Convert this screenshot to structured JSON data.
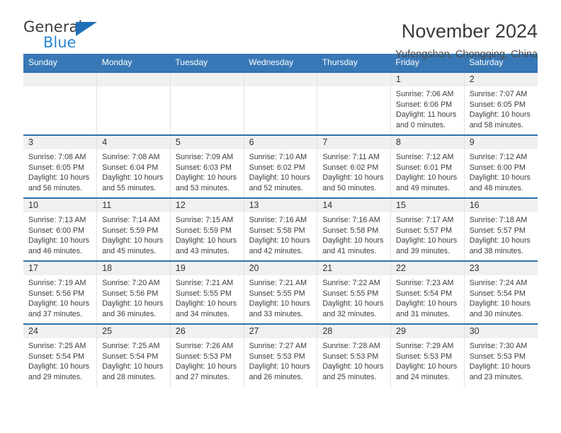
{
  "brand": {
    "name_part1": "General",
    "name_part2": "Blue",
    "accent_color": "#2a86d0",
    "triangle_color": "#1f6fb8"
  },
  "header": {
    "title": "November 2024",
    "subtitle": "Yufengshan, Chongqing, China",
    "header_bg_color": "#3878b6",
    "row_border_color": "#2f6fae"
  },
  "weekdays": [
    "Sunday",
    "Monday",
    "Tuesday",
    "Wednesday",
    "Thursday",
    "Friday",
    "Saturday"
  ],
  "weeks": [
    [
      {
        "day": "",
        "sunrise": "",
        "sunset": "",
        "daylight1": "",
        "daylight2": ""
      },
      {
        "day": "",
        "sunrise": "",
        "sunset": "",
        "daylight1": "",
        "daylight2": ""
      },
      {
        "day": "",
        "sunrise": "",
        "sunset": "",
        "daylight1": "",
        "daylight2": ""
      },
      {
        "day": "",
        "sunrise": "",
        "sunset": "",
        "daylight1": "",
        "daylight2": ""
      },
      {
        "day": "",
        "sunrise": "",
        "sunset": "",
        "daylight1": "",
        "daylight2": ""
      },
      {
        "day": "1",
        "sunrise": "Sunrise: 7:06 AM",
        "sunset": "Sunset: 6:06 PM",
        "daylight1": "Daylight: 11 hours",
        "daylight2": "and 0 minutes."
      },
      {
        "day": "2",
        "sunrise": "Sunrise: 7:07 AM",
        "sunset": "Sunset: 6:05 PM",
        "daylight1": "Daylight: 10 hours",
        "daylight2": "and 58 minutes."
      }
    ],
    [
      {
        "day": "3",
        "sunrise": "Sunrise: 7:08 AM",
        "sunset": "Sunset: 6:05 PM",
        "daylight1": "Daylight: 10 hours",
        "daylight2": "and 56 minutes."
      },
      {
        "day": "4",
        "sunrise": "Sunrise: 7:08 AM",
        "sunset": "Sunset: 6:04 PM",
        "daylight1": "Daylight: 10 hours",
        "daylight2": "and 55 minutes."
      },
      {
        "day": "5",
        "sunrise": "Sunrise: 7:09 AM",
        "sunset": "Sunset: 6:03 PM",
        "daylight1": "Daylight: 10 hours",
        "daylight2": "and 53 minutes."
      },
      {
        "day": "6",
        "sunrise": "Sunrise: 7:10 AM",
        "sunset": "Sunset: 6:02 PM",
        "daylight1": "Daylight: 10 hours",
        "daylight2": "and 52 minutes."
      },
      {
        "day": "7",
        "sunrise": "Sunrise: 7:11 AM",
        "sunset": "Sunset: 6:02 PM",
        "daylight1": "Daylight: 10 hours",
        "daylight2": "and 50 minutes."
      },
      {
        "day": "8",
        "sunrise": "Sunrise: 7:12 AM",
        "sunset": "Sunset: 6:01 PM",
        "daylight1": "Daylight: 10 hours",
        "daylight2": "and 49 minutes."
      },
      {
        "day": "9",
        "sunrise": "Sunrise: 7:12 AM",
        "sunset": "Sunset: 6:00 PM",
        "daylight1": "Daylight: 10 hours",
        "daylight2": "and 48 minutes."
      }
    ],
    [
      {
        "day": "10",
        "sunrise": "Sunrise: 7:13 AM",
        "sunset": "Sunset: 6:00 PM",
        "daylight1": "Daylight: 10 hours",
        "daylight2": "and 46 minutes."
      },
      {
        "day": "11",
        "sunrise": "Sunrise: 7:14 AM",
        "sunset": "Sunset: 5:59 PM",
        "daylight1": "Daylight: 10 hours",
        "daylight2": "and 45 minutes."
      },
      {
        "day": "12",
        "sunrise": "Sunrise: 7:15 AM",
        "sunset": "Sunset: 5:59 PM",
        "daylight1": "Daylight: 10 hours",
        "daylight2": "and 43 minutes."
      },
      {
        "day": "13",
        "sunrise": "Sunrise: 7:16 AM",
        "sunset": "Sunset: 5:58 PM",
        "daylight1": "Daylight: 10 hours",
        "daylight2": "and 42 minutes."
      },
      {
        "day": "14",
        "sunrise": "Sunrise: 7:16 AM",
        "sunset": "Sunset: 5:58 PM",
        "daylight1": "Daylight: 10 hours",
        "daylight2": "and 41 minutes."
      },
      {
        "day": "15",
        "sunrise": "Sunrise: 7:17 AM",
        "sunset": "Sunset: 5:57 PM",
        "daylight1": "Daylight: 10 hours",
        "daylight2": "and 39 minutes."
      },
      {
        "day": "16",
        "sunrise": "Sunrise: 7:18 AM",
        "sunset": "Sunset: 5:57 PM",
        "daylight1": "Daylight: 10 hours",
        "daylight2": "and 38 minutes."
      }
    ],
    [
      {
        "day": "17",
        "sunrise": "Sunrise: 7:19 AM",
        "sunset": "Sunset: 5:56 PM",
        "daylight1": "Daylight: 10 hours",
        "daylight2": "and 37 minutes."
      },
      {
        "day": "18",
        "sunrise": "Sunrise: 7:20 AM",
        "sunset": "Sunset: 5:56 PM",
        "daylight1": "Daylight: 10 hours",
        "daylight2": "and 36 minutes."
      },
      {
        "day": "19",
        "sunrise": "Sunrise: 7:21 AM",
        "sunset": "Sunset: 5:55 PM",
        "daylight1": "Daylight: 10 hours",
        "daylight2": "and 34 minutes."
      },
      {
        "day": "20",
        "sunrise": "Sunrise: 7:21 AM",
        "sunset": "Sunset: 5:55 PM",
        "daylight1": "Daylight: 10 hours",
        "daylight2": "and 33 minutes."
      },
      {
        "day": "21",
        "sunrise": "Sunrise: 7:22 AM",
        "sunset": "Sunset: 5:55 PM",
        "daylight1": "Daylight: 10 hours",
        "daylight2": "and 32 minutes."
      },
      {
        "day": "22",
        "sunrise": "Sunrise: 7:23 AM",
        "sunset": "Sunset: 5:54 PM",
        "daylight1": "Daylight: 10 hours",
        "daylight2": "and 31 minutes."
      },
      {
        "day": "23",
        "sunrise": "Sunrise: 7:24 AM",
        "sunset": "Sunset: 5:54 PM",
        "daylight1": "Daylight: 10 hours",
        "daylight2": "and 30 minutes."
      }
    ],
    [
      {
        "day": "24",
        "sunrise": "Sunrise: 7:25 AM",
        "sunset": "Sunset: 5:54 PM",
        "daylight1": "Daylight: 10 hours",
        "daylight2": "and 29 minutes."
      },
      {
        "day": "25",
        "sunrise": "Sunrise: 7:25 AM",
        "sunset": "Sunset: 5:54 PM",
        "daylight1": "Daylight: 10 hours",
        "daylight2": "and 28 minutes."
      },
      {
        "day": "26",
        "sunrise": "Sunrise: 7:26 AM",
        "sunset": "Sunset: 5:53 PM",
        "daylight1": "Daylight: 10 hours",
        "daylight2": "and 27 minutes."
      },
      {
        "day": "27",
        "sunrise": "Sunrise: 7:27 AM",
        "sunset": "Sunset: 5:53 PM",
        "daylight1": "Daylight: 10 hours",
        "daylight2": "and 26 minutes."
      },
      {
        "day": "28",
        "sunrise": "Sunrise: 7:28 AM",
        "sunset": "Sunset: 5:53 PM",
        "daylight1": "Daylight: 10 hours",
        "daylight2": "and 25 minutes."
      },
      {
        "day": "29",
        "sunrise": "Sunrise: 7:29 AM",
        "sunset": "Sunset: 5:53 PM",
        "daylight1": "Daylight: 10 hours",
        "daylight2": "and 24 minutes."
      },
      {
        "day": "30",
        "sunrise": "Sunrise: 7:30 AM",
        "sunset": "Sunset: 5:53 PM",
        "daylight1": "Daylight: 10 hours",
        "daylight2": "and 23 minutes."
      }
    ]
  ]
}
